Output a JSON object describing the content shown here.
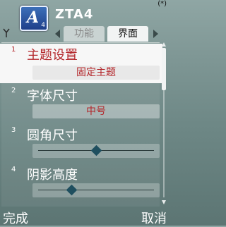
{
  "status": {
    "indicator": "(*)"
  },
  "header": {
    "app_icon": {
      "letter": "A",
      "sub": "4"
    },
    "title": "ZTA4",
    "tabs": [
      {
        "label": "功能",
        "active": false
      },
      {
        "label": "界面",
        "active": true
      }
    ]
  },
  "list": {
    "items": [
      {
        "index": "1",
        "label": "主题设置",
        "value": "固定主题",
        "kind": "text",
        "selected": true
      },
      {
        "index": "2",
        "label": "字体尺寸",
        "value": "中号",
        "kind": "text",
        "selected": false
      },
      {
        "index": "3",
        "label": "圆角尺寸",
        "kind": "slider",
        "level": 0.5,
        "selected": false
      },
      {
        "index": "4",
        "label": "阴影高度",
        "kind": "slider",
        "level": 0.29,
        "selected": false
      }
    ]
  },
  "softkeys": {
    "left": "完成",
    "right": "取消"
  },
  "colors": {
    "accent": "#b3262a",
    "selection_bg": "#f7f7f7",
    "knob": "#1f4f5f"
  }
}
